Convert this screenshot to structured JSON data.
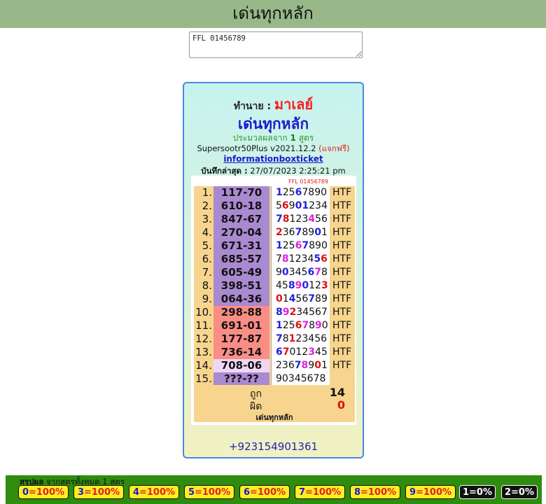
{
  "header": {
    "title": "เด่นทุกหลัก"
  },
  "formula_input": {
    "value": "FFL 01456789"
  },
  "card": {
    "owner_label": "ทำนาย :",
    "owner_name": "มาเลย์",
    "title": "เด่นทุกหลัก",
    "process_prefix": "ประมวลผลจาก",
    "process_count": "1",
    "process_suffix": "สูตร",
    "version": "Supersootr50Plus v2021.12.2",
    "free_label": "(แจกฟรี)",
    "info_link": "informationboxticket",
    "saved_label": "บันทึกล่าสุด :",
    "saved_value": "27/07/2023 2:25:21 pm",
    "formula_head": "FFL 01456789",
    "rows": [
      {
        "no": "1.",
        "pair": "117-70",
        "digits": "12567890",
        "tag": "HTF"
      },
      {
        "no": "2.",
        "pair": "610-18",
        "digits": "56901234",
        "tag": "HTF"
      },
      {
        "no": "3.",
        "pair": "847-67",
        "digits": "78123456",
        "tag": "HTF"
      },
      {
        "no": "4.",
        "pair": "270-04",
        "digits": "23678901",
        "tag": "HTF"
      },
      {
        "no": "5.",
        "pair": "671-31",
        "digits": "12567890",
        "tag": "HTF"
      },
      {
        "no": "6.",
        "pair": "685-57",
        "digits": "78123456",
        "tag": "HTF"
      },
      {
        "no": "7.",
        "pair": "605-49",
        "digits": "90345678",
        "tag": "HTF"
      },
      {
        "no": "8.",
        "pair": "398-51",
        "digits": "45890123",
        "tag": "HTF"
      },
      {
        "no": "9.",
        "pair": "064-36",
        "digits": "01456789",
        "tag": "HTF"
      },
      {
        "no": "10.",
        "pair": "298-88",
        "digits": "89234567",
        "tag": "HTF"
      },
      {
        "no": "11.",
        "pair": "691-01",
        "digits": "12567890",
        "tag": "HTF"
      },
      {
        "no": "12.",
        "pair": "177-87",
        "digits": "78123456",
        "tag": "HTF"
      },
      {
        "no": "13.",
        "pair": "736-14",
        "digits": "67012345",
        "tag": "HTF"
      },
      {
        "no": "14.",
        "pair": "708-06",
        "digits": "23678901",
        "tag": "HTF"
      },
      {
        "no": "15.",
        "pair": "???-??",
        "digits": "90345678",
        "tag": ""
      }
    ],
    "row_colors": [
      "#a98ad0",
      "#a98ad0",
      "#a98ad0",
      "#a98ad0",
      "#a98ad0",
      "#a98ad0",
      "#a98ad0",
      "#a98ad0",
      "#a98ad0",
      "#fa8d85",
      "#fa8d85",
      "#fa8d85",
      "#fa8d85",
      "#efd6f5",
      "#a98ad0"
    ],
    "correct_label": "ถูก",
    "correct_value": "14",
    "wrong_label": "ผิด",
    "wrong_value": "0",
    "footer_title": "เด่นทุกหลัก",
    "phone": "+923154901361"
  },
  "summary": {
    "label_bold": "สรุปผล",
    "label_rest": "จากสูตรทั้งหมด 1 สูตร",
    "chips": [
      {
        "digit": "0",
        "text": "=100%"
      },
      {
        "digit": "3",
        "text": "=100%"
      },
      {
        "digit": "4",
        "text": "=100%"
      },
      {
        "digit": "5",
        "text": "=100%"
      },
      {
        "digit": "6",
        "text": "=100%"
      },
      {
        "digit": "7",
        "text": "=100%"
      },
      {
        "digit": "8",
        "text": "=100%"
      },
      {
        "digit": "9",
        "text": "=100%"
      },
      {
        "digit": "1",
        "text": "=0%"
      },
      {
        "digit": "2",
        "text": "=0%"
      }
    ]
  }
}
